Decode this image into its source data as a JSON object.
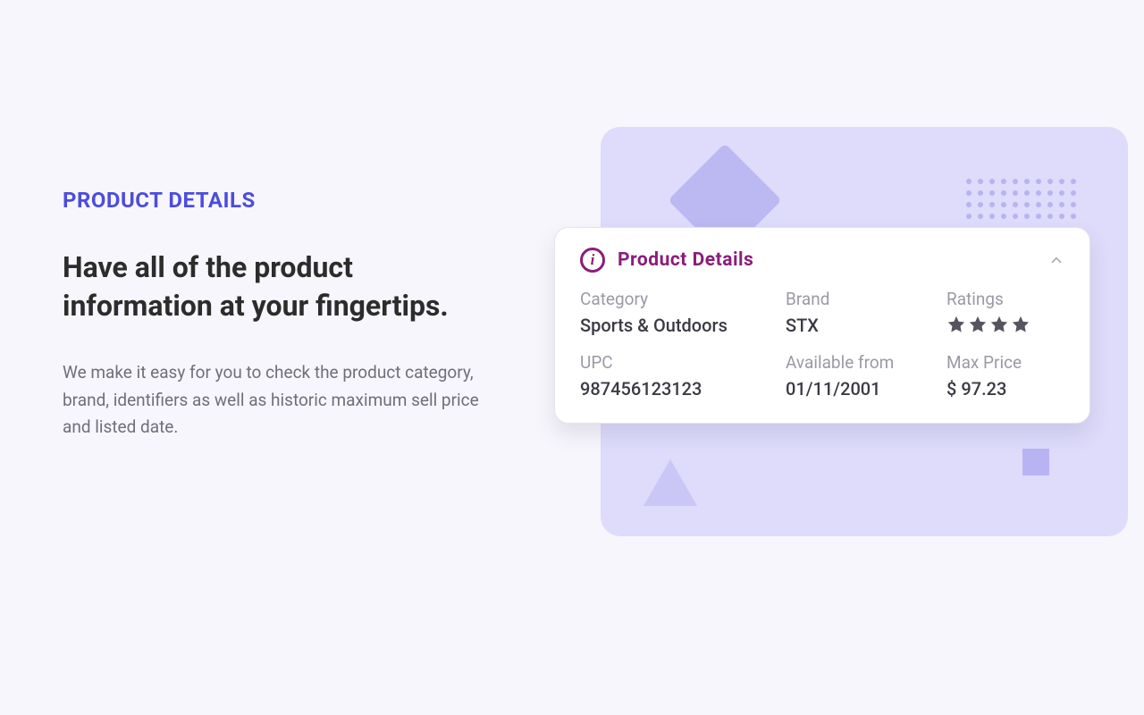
{
  "left": {
    "eyebrow": "PRODUCT DETAILS",
    "headline": "Have all of the product information at your fingertips.",
    "body": "We make it easy for you to check the product category, brand, identifiers as well as historic maximum sell price and listed date."
  },
  "card": {
    "title": "Product  Details",
    "rating_stars": 4,
    "fields": {
      "category": {
        "label": "Category",
        "value": "Sports & Outdoors"
      },
      "brand": {
        "label": "Brand",
        "value": "STX"
      },
      "ratings": {
        "label": "Ratings"
      },
      "upc": {
        "label": "UPC",
        "value": "987456123123"
      },
      "available": {
        "label": "Available from",
        "value": "01/11/2001"
      },
      "maxprice": {
        "label": "Max Price",
        "value": "$ 97.23"
      }
    }
  }
}
